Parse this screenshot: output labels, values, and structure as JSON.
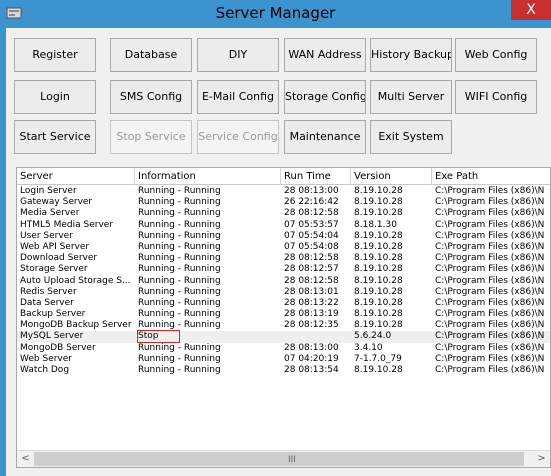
{
  "window": {
    "title": "Server Manager",
    "close_glyph": "X",
    "icon": "app-icon"
  },
  "buttons": [
    {
      "id": "register",
      "label": "Register",
      "enabled": true
    },
    {
      "id": "database",
      "label": "Database",
      "enabled": true
    },
    {
      "id": "diy",
      "label": "DIY",
      "enabled": true
    },
    {
      "id": "wan-address",
      "label": "WAN Address",
      "enabled": true
    },
    {
      "id": "history-backup",
      "label": "History Backup",
      "enabled": true
    },
    {
      "id": "web-config",
      "label": "Web Config",
      "enabled": true
    },
    {
      "id": "login",
      "label": "Login",
      "enabled": true
    },
    {
      "id": "sms-config",
      "label": "SMS Config",
      "enabled": true
    },
    {
      "id": "email-config",
      "label": "E-Mail Config",
      "enabled": true
    },
    {
      "id": "storage-config",
      "label": "Storage Config",
      "enabled": true
    },
    {
      "id": "multi-server",
      "label": "Multi Server",
      "enabled": true
    },
    {
      "id": "wifi-config",
      "label": "WIFI Config",
      "enabled": true
    },
    {
      "id": "start-service",
      "label": "Start Service",
      "enabled": true
    },
    {
      "id": "stop-service",
      "label": "Stop Service",
      "enabled": false
    },
    {
      "id": "service-config",
      "label": "Service Config",
      "enabled": false
    },
    {
      "id": "maintenance",
      "label": "Maintenance",
      "enabled": true
    },
    {
      "id": "exit-system",
      "label": "Exit System",
      "enabled": true
    }
  ],
  "table": {
    "columns": [
      "Server",
      "Information",
      "Run Time",
      "Version",
      "Exe Path"
    ],
    "rows": [
      [
        "Login Server",
        "Running - Running",
        "28 08:13:00",
        "8.19.10.28",
        "C:\\Program Files (x86)\\N"
      ],
      [
        "Gateway Server",
        "Running - Running",
        "26 22:16:42",
        "8.19.10.28",
        "C:\\Program Files (x86)\\N"
      ],
      [
        "Media Server",
        "Running - Running",
        "28 08:12:58",
        "8.19.10.28",
        "C:\\Program Files (x86)\\N"
      ],
      [
        "HTML5 Media Server",
        "Running - Running",
        "07 05:53:57",
        "8.18.1.30",
        "C:\\Program Files (x86)\\N"
      ],
      [
        "User Server",
        "Running - Running",
        "07 05:54:04",
        "8.19.10.28",
        "C:\\Program Files (x86)\\N"
      ],
      [
        "Web API Server",
        "Running - Running",
        "07 05:54:08",
        "8.19.10.28",
        "C:\\Program Files (x86)\\N"
      ],
      [
        "Download Server",
        "Running - Running",
        "28 08:12:58",
        "8.19.10.28",
        "C:\\Program Files (x86)\\N"
      ],
      [
        "Storage Server",
        "Running - Running",
        "28 08:12:57",
        "8.19.10.28",
        "C:\\Program Files (x86)\\N"
      ],
      [
        "Auto Upload Storage S...",
        "Running - Running",
        "28 08:12:58",
        "8.19.10.28",
        "C:\\Program Files (x86)\\N"
      ],
      [
        "Redis Server",
        "Running - Running",
        "28 08:13:01",
        "8.19.10.28",
        "C:\\Program Files (x86)\\N"
      ],
      [
        "Data Server",
        "Running - Running",
        "28 08:13:22",
        "8.19.10.28",
        "C:\\Program Files (x86)\\N"
      ],
      [
        "Backup Server",
        "Running - Running",
        "28 08:13:19",
        "8.19.10.28",
        "C:\\Program Files (x86)\\N"
      ],
      [
        "MongoDB Backup Server",
        "Running - Running",
        "28 08:12:35",
        "8.19.10.28",
        "C:\\Program Files (x86)\\N"
      ],
      [
        "MySQL Server",
        "Stop",
        "",
        "5.6.24.0",
        "C:\\Program Files (x86)\\N"
      ],
      [
        "MongoDB Server",
        "Running - Running",
        "28 08:13:00",
        "3.4.10",
        "C:\\Program Files (x86)\\N"
      ],
      [
        "Web Server",
        "Running - Running",
        "07 04:20:19",
        "7-1.7.0_79",
        "C:\\Program Files (x86)\\N"
      ],
      [
        "Watch Dog",
        "Running - Running",
        "28 08:13:54",
        "8.19.10.28",
        "C:\\Program Files (x86)\\N"
      ]
    ],
    "highlighted_row": 13,
    "highlight_color": "#e02020"
  },
  "scrollbar": {
    "left_arrow": "<",
    "right_arrow": ">",
    "grip": "III"
  }
}
